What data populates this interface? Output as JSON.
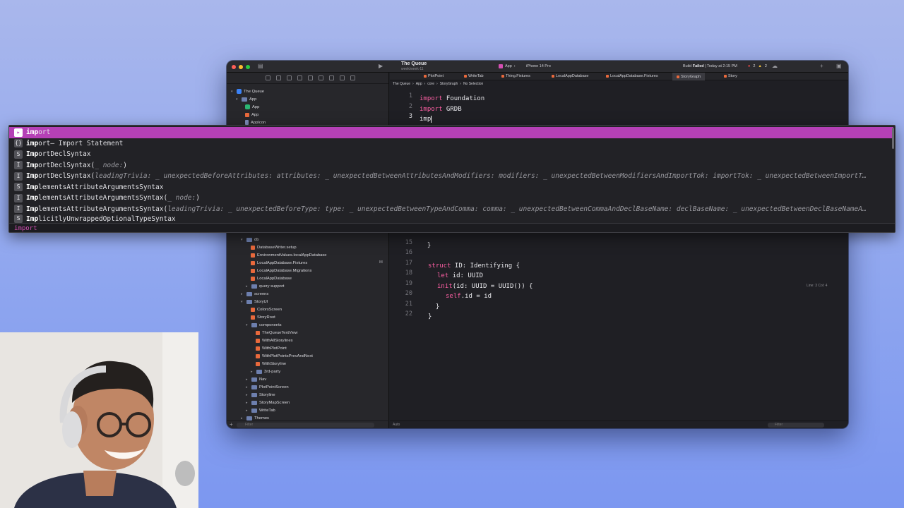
{
  "project": {
    "name": "The Queue",
    "branch": "week/week-11",
    "scheme": "App",
    "device": "iPhone 14 Pro",
    "status_prefix": "Build",
    "status_bold": "Failed",
    "status_suffix": "| Today at 2:15 PM",
    "errors": "2",
    "warnings": "2"
  },
  "tabs": [
    "PlotPoint",
    "WriteTab",
    "Thing.Fixtures",
    "LocalAppDatabase",
    "LocalAppDatabase.Fixtures",
    "StoryGraph",
    "Story"
  ],
  "active_tab_index": 5,
  "breadcrumb": [
    "The Queue",
    "App",
    "core",
    "StoryGraph",
    "No Selection"
  ],
  "navigator": {
    "root": "The Queue",
    "app_group": "App",
    "app_files": [
      "App",
      "App",
      "AppIcon"
    ],
    "db_folder": "db",
    "db_files": [
      "DatabaseWriter.setup",
      "EnvironmentValues.localAppDatabase",
      "LocalAppDatabase.Fixtures",
      "LocalAppDatabase.Migrations",
      "LocalAppDatabase"
    ],
    "modified_tag": "M",
    "query_support": "query support",
    "screens": "screens",
    "storyui": "StoryUI",
    "storyui_files": [
      "ColorsScreen",
      "StoryRoot"
    ],
    "components": "components",
    "component_files": [
      "TheQueueTextView",
      "WithAllStorylines",
      "WithPlotPoint",
      "WithPlotPointsPrevAndNext",
      "WithStoryline"
    ],
    "third_party": "3rd-party",
    "more_folders": [
      "Nav",
      "PlotPointScreen",
      "Storyline",
      "StoryMapScreen",
      "WriteTab",
      "Themes"
    ],
    "filter_placeholder": "Filter"
  },
  "code_top": [
    {
      "n": "1",
      "kw": "import",
      "rest": " Foundation"
    },
    {
      "n": "2",
      "kw": "import",
      "rest": " GRDB"
    },
    {
      "n": "3",
      "kw": "",
      "rest": "imp"
    }
  ],
  "code_bottom": [
    {
      "n": "15",
      "text": "  }"
    },
    {
      "n": "16",
      "text": ""
    },
    {
      "n": "17",
      "kw": "struct",
      "rest": " ID: Identifying {"
    },
    {
      "n": "18",
      "kw": "let",
      "rest": " id: UUID"
    },
    {
      "n": "19",
      "kw": "init",
      "rest": "(id: UUID = UUID()) {"
    },
    {
      "n": "20",
      "kw": "self",
      "rest": ".id = id"
    },
    {
      "n": "21",
      "text": "  }"
    },
    {
      "n": "22",
      "text": "}"
    }
  ],
  "line_info": "Line: 3  Col: 4",
  "editor_bottom_left": "Auto",
  "completions": [
    {
      "badge": "▸",
      "bold": "imp",
      "rest": "ort",
      "selected": true
    },
    {
      "badge": "{}",
      "bold": "imp",
      "rest": "ort",
      "detail": " — Import Statement"
    },
    {
      "badge": "S",
      "bold": "Imp",
      "rest": "ortDeclSyntax"
    },
    {
      "badge": "I",
      "bold": "Imp",
      "rest": "ortDeclSyntax(",
      "detail": "_ node:",
      "tail": ")"
    },
    {
      "badge": "I",
      "bold": "Imp",
      "rest": "ortDeclSyntax(",
      "detail": "leadingTrivia: _ unexpectedBeforeAttributes: attributes: _ unexpectedBetweenAttributesAndModifiers: modifiers: _ unexpectedBetweenModifiersAndImportTok: importTok: _ unexpectedBetweenImportT…"
    },
    {
      "badge": "S",
      "bold": "Imp",
      "rest": "lementsAttributeArgumentsSyntax"
    },
    {
      "badge": "I",
      "bold": "Imp",
      "rest": "lementsAttributeArgumentsSyntax(",
      "detail": "_ node:",
      "tail": ")"
    },
    {
      "badge": "I",
      "bold": "Imp",
      "rest": "lementsAttributeArgumentsSyntax(",
      "detail": "leadingTrivia: _ unexpectedBeforeType: type: _ unexpectedBetweenTypeAndComma: comma: _ unexpectedBetweenCommaAndDeclBaseName: declBaseName: _ unexpectedBetweenDeclBaseNameA…"
    },
    {
      "badge": "S",
      "bold": "Imp",
      "rest": "licitlyUnwrappedOptionalTypeSyntax"
    }
  ],
  "completion_footer": "import",
  "colors": {
    "selection": "#b540b6",
    "keyword": "#fc5fa3",
    "desktop": "#8fa6ef"
  }
}
